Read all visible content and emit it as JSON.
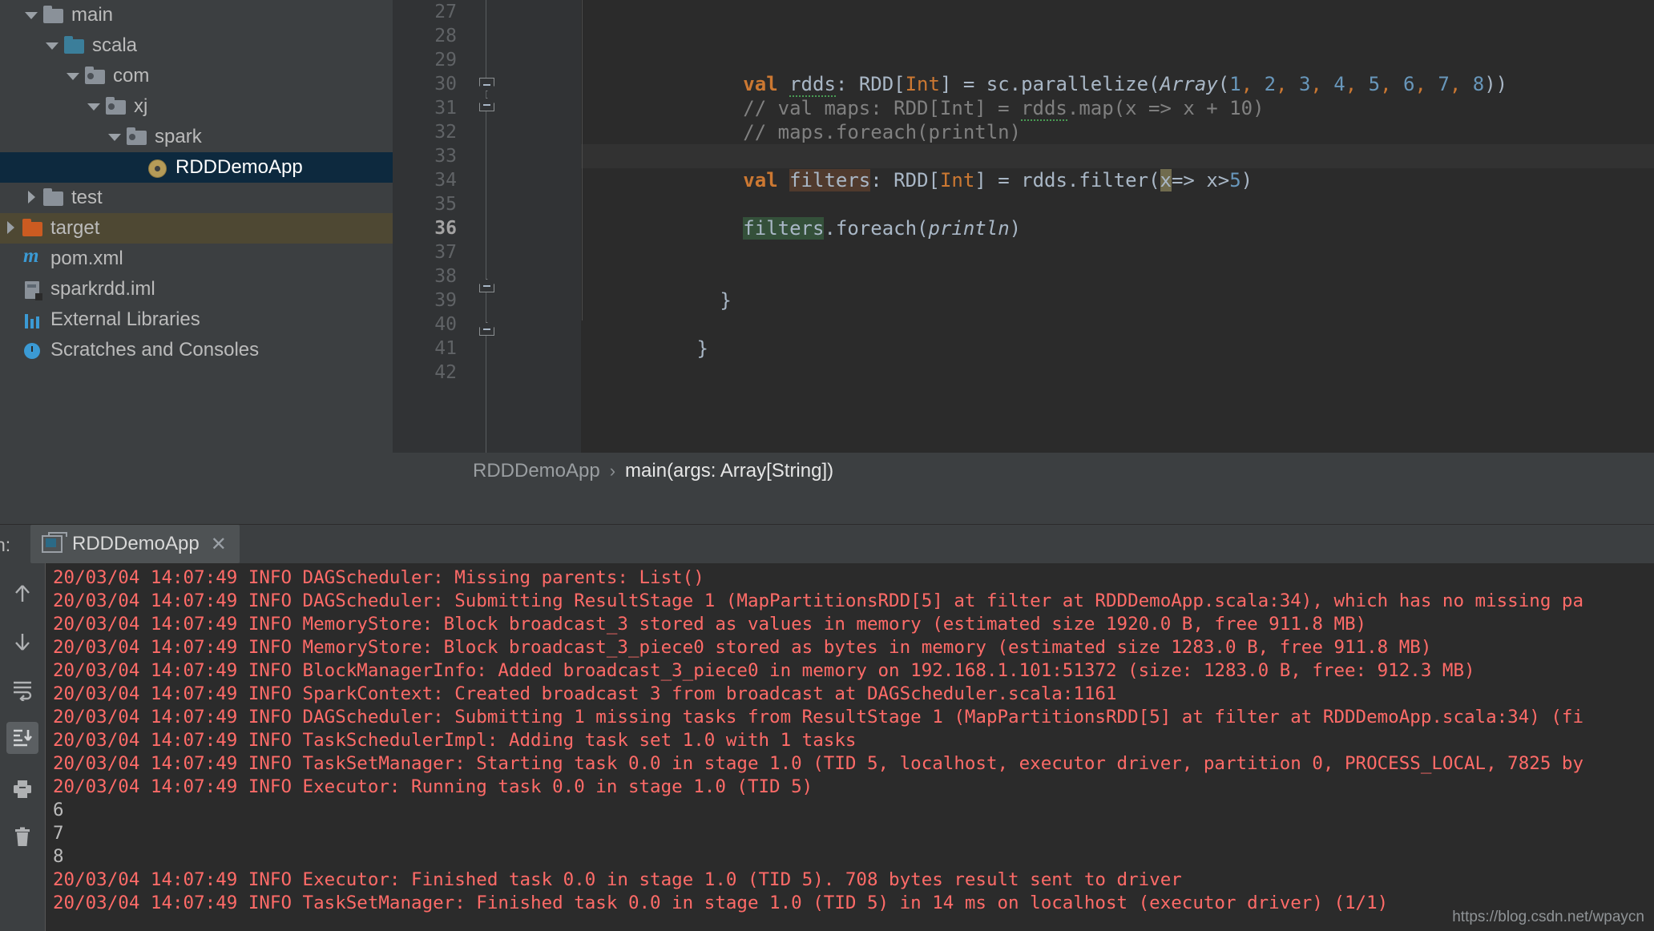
{
  "project_tree": {
    "items": [
      {
        "label": "main",
        "indent": 1,
        "twisty": "down",
        "icon": "folder-gray",
        "state": "normal"
      },
      {
        "label": "scala",
        "indent": 2,
        "twisty": "down",
        "icon": "folder-blue",
        "state": "normal"
      },
      {
        "label": "com",
        "indent": 3,
        "twisty": "down",
        "icon": "folder-package",
        "state": "normal"
      },
      {
        "label": "xj",
        "indent": 4,
        "twisty": "down",
        "icon": "folder-package",
        "state": "normal"
      },
      {
        "label": "spark",
        "indent": 5,
        "twisty": "down",
        "icon": "folder-package",
        "state": "normal"
      },
      {
        "label": "RDDDemoApp",
        "indent": 6,
        "twisty": "none",
        "icon": "scala-object",
        "state": "selected"
      },
      {
        "label": "test",
        "indent": 1,
        "twisty": "right",
        "icon": "folder-gray",
        "state": "normal"
      },
      {
        "label": "target",
        "indent": 0,
        "twisty": "right",
        "icon": "folder-orange",
        "state": "target"
      },
      {
        "label": "pom.xml",
        "indent": 0,
        "twisty": "none",
        "icon": "maven-m",
        "state": "normal"
      },
      {
        "label": "sparkrdd.iml",
        "indent": 0,
        "twisty": "none",
        "icon": "iml-file",
        "state": "normal"
      },
      {
        "label": "External Libraries",
        "indent": -1,
        "twisty": "none",
        "icon": "library",
        "state": "normal"
      },
      {
        "label": "Scratches and Consoles",
        "indent": -1,
        "twisty": "none",
        "icon": "scratches",
        "state": "normal"
      }
    ]
  },
  "editor": {
    "line_numbers": [
      "27",
      "28",
      "29",
      "30",
      "31",
      "32",
      "33",
      "34",
      "35",
      "36",
      "37",
      "38",
      "39",
      "40",
      "41",
      "42"
    ],
    "current_line": "36",
    "lines": [
      {
        "n": "27",
        "text": ""
      },
      {
        "n": "28",
        "text": ""
      },
      {
        "n": "29",
        "text": ""
      },
      {
        "n": "30",
        "text": "    val rdds: RDD[Int] = sc.parallelize(Array(1, 2, 3, 4, 5, 6, 7, 8))"
      },
      {
        "n": "31",
        "text": "    // val maps: RDD[Int] = rdds.map(x => x + 10)"
      },
      {
        "n": "32",
        "text": "    // maps.foreach(println)"
      },
      {
        "n": "33",
        "text": ""
      },
      {
        "n": "34",
        "text": "    val filters: RDD[Int] = rdds.filter(x=> x>5)"
      },
      {
        "n": "35",
        "text": ""
      },
      {
        "n": "36",
        "text": "    filters.foreach(println)"
      },
      {
        "n": "37",
        "text": ""
      },
      {
        "n": "38",
        "text": ""
      },
      {
        "n": "39",
        "text": "  }"
      },
      {
        "n": "40",
        "text": ""
      },
      {
        "n": "41",
        "text": "}"
      },
      {
        "n": "42",
        "text": ""
      }
    ],
    "tokens": {
      "kw_val": "val",
      "name_rdds": "rdds",
      "colon": ": ",
      "rdd_open": "RDD[",
      "int_type": "Int",
      "rdd_close": "] = ",
      "sc_parallelize": "sc.parallelize(",
      "array_kw": "Array",
      "paren_open": "(",
      "arr_1": "1",
      "arr_2": "2",
      "arr_3": "3",
      "arr_4": "4",
      "arr_5": "5",
      "arr_6": "6",
      "arr_7": "7",
      "arr_8": "8",
      "comma": ", ",
      "close_2": "))",
      "comment_31": "// val maps: RDD[Int] = rdds.map(x => x + 10)",
      "comment_31_a": "// val maps: RDD[Int] = ",
      "comment_31_b": "rdds",
      "comment_31_c": ".map(x => x + 10)",
      "comment_32": "// maps.foreach(println)",
      "name_filters": "filters",
      "rdds_filter": "rdds.filter(",
      "lambda_x": "x",
      "lambda_arrow": "=> x>",
      "five": "5",
      "close_1": ")",
      "foreach": ".foreach(",
      "println": "println",
      "brace_close": "}",
      "indent4": "    ",
      "indent2": "  "
    },
    "breadcrumb": {
      "parent": "RDDDemoApp",
      "separator": "›",
      "current": "main(args: Array[String])"
    }
  },
  "console": {
    "run_label": "n:",
    "tab": {
      "label": "RDDDemoApp",
      "close": "✕",
      "icon": "run-configuration-icon"
    },
    "toolbar": [
      {
        "name": "up-arrow-icon",
        "active": false
      },
      {
        "name": "down-arrow-icon",
        "active": false
      },
      {
        "name": "soft-wrap-icon",
        "active": false
      },
      {
        "name": "scroll-to-end-icon",
        "active": true
      },
      {
        "name": "print-icon",
        "active": false
      },
      {
        "name": "trash-icon",
        "active": false
      }
    ],
    "log_lines": [
      {
        "type": "info",
        "text": "20/03/04 14:07:49 INFO DAGScheduler: Missing parents: List()"
      },
      {
        "type": "info",
        "text": "20/03/04 14:07:49 INFO DAGScheduler: Submitting ResultStage 1 (MapPartitionsRDD[5] at filter at RDDDemoApp.scala:34), which has no missing pa"
      },
      {
        "type": "info",
        "text": "20/03/04 14:07:49 INFO MemoryStore: Block broadcast_3 stored as values in memory (estimated size 1920.0 B, free 911.8 MB)"
      },
      {
        "type": "info",
        "text": "20/03/04 14:07:49 INFO MemoryStore: Block broadcast_3_piece0 stored as bytes in memory (estimated size 1283.0 B, free 911.8 MB)"
      },
      {
        "type": "info",
        "text": "20/03/04 14:07:49 INFO BlockManagerInfo: Added broadcast_3_piece0 in memory on 192.168.1.101:51372 (size: 1283.0 B, free: 912.3 MB)"
      },
      {
        "type": "info",
        "text": "20/03/04 14:07:49 INFO SparkContext: Created broadcast 3 from broadcast at DAGScheduler.scala:1161"
      },
      {
        "type": "info",
        "text": "20/03/04 14:07:49 INFO DAGScheduler: Submitting 1 missing tasks from ResultStage 1 (MapPartitionsRDD[5] at filter at RDDDemoApp.scala:34) (fi"
      },
      {
        "type": "info",
        "text": "20/03/04 14:07:49 INFO TaskSchedulerImpl: Adding task set 1.0 with 1 tasks"
      },
      {
        "type": "info",
        "text": "20/03/04 14:07:49 INFO TaskSetManager: Starting task 0.0 in stage 1.0 (TID 5, localhost, executor driver, partition 0, PROCESS_LOCAL, 7825 by"
      },
      {
        "type": "info",
        "text": "20/03/04 14:07:49 INFO Executor: Running task 0.0 in stage 1.0 (TID 5)"
      },
      {
        "type": "output",
        "text": "6"
      },
      {
        "type": "output",
        "text": "7"
      },
      {
        "type": "output",
        "text": "8"
      },
      {
        "type": "info",
        "text": "20/03/04 14:07:49 INFO Executor: Finished task 0.0 in stage 1.0 (TID 5). 708 bytes result sent to driver"
      },
      {
        "type": "info",
        "text": "20/03/04 14:07:49 INFO TaskSetManager: Finished task 0.0 in stage 1.0 (TID 5) in 14 ms on localhost (executor driver) (1/1)"
      }
    ]
  },
  "watermark": {
    "url": "https://blog.csdn.net/wpaycn"
  },
  "colors": {
    "panel_bg": "#3c3f41",
    "editor_bg": "#2b2b2b",
    "gutter_bg": "#313335",
    "selection_blue": "#0d293e",
    "target_olive": "#4e4833",
    "keyword_orange": "#cc7832",
    "number_blue": "#6897bb",
    "comment_gray": "#808080",
    "text_gray": "#a9b7c6",
    "log_red": "#ff6b68",
    "output_gray": "#bbbbbb"
  }
}
